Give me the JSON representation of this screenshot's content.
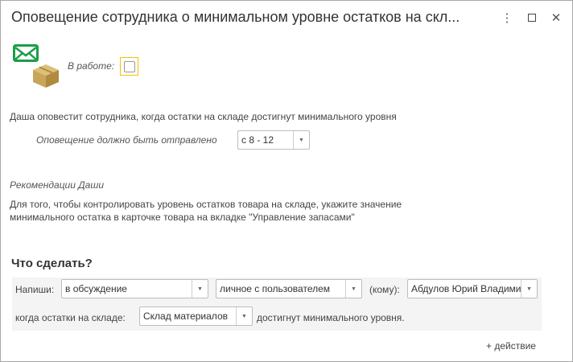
{
  "window": {
    "title": "Оповещение сотрудника о минимальном уровне остатков на скл...",
    "icons": [
      "more-vertical-icon",
      "maximize-icon",
      "close-icon"
    ]
  },
  "header": {
    "in_work_label": "В работе:",
    "in_work_checked": false
  },
  "description": "Даша оповестит сотрудника, когда остатки на складе достигнут минимального уровня",
  "schedule": {
    "label": "Оповещение должно быть отправлено",
    "value": "с 8 - 12"
  },
  "recommendations": {
    "title": "Рекомендации Даши",
    "line1": "Для того, чтобы контролировать уровень остатков товара на складе, укажите значение",
    "line2": "минимального остатка в карточке товара на вкладке \"Управление запасами\""
  },
  "action": {
    "heading": "Что сделать?",
    "write_label": "Напиши:",
    "channel": "в обсуждение",
    "discussion": "личное с пользователем",
    "to_label": "(кому):",
    "recipient": "Абдулов Юрий Владимирович",
    "when_label": "когда остатки на складе:",
    "warehouse": "Склад материалов",
    "suffix": "достигнут минимального уровня.",
    "add_action": "+ действие"
  },
  "colors": {
    "envelope": "#1a9e4a",
    "box": "#c9a55a",
    "focus": "#f2c200"
  }
}
